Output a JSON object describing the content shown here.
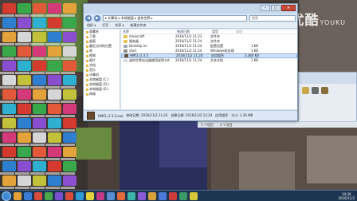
{
  "watermark": {
    "brand": "优酷",
    "sub": "YOUKU"
  },
  "window": {
    "address": "▸ 计算机 ▸ 本地磁盘 ▸ 迷你世界 ▸",
    "search_placeholder": "搜索",
    "buttons": {
      "minimize": "–",
      "maximize": "□",
      "close": "✕"
    }
  },
  "toolbar": {
    "items": [
      "组织 ▾",
      "打开",
      "共享 ▾",
      "新建文件夹"
    ]
  },
  "nav_pane": {
    "items": [
      {
        "label": "收藏夹"
      },
      {
        "label": "下载"
      },
      {
        "label": "桌面"
      },
      {
        "label": "最近访问的位置"
      },
      {
        "label": "库"
      },
      {
        "label": "视频"
      },
      {
        "label": "图片"
      },
      {
        "label": "文档"
      },
      {
        "label": "音乐"
      },
      {
        "label": "计算机"
      },
      {
        "label": "本地磁盘 (C:)"
      },
      {
        "label": "本地磁盘 (D:)"
      },
      {
        "label": "本地磁盘 (E:)"
      },
      {
        "label": "网络"
      }
    ]
  },
  "columns": {
    "name": "名称",
    "date": "修改日期",
    "type": "类型",
    "size": "大小"
  },
  "files": [
    {
      "name": "minecraft",
      "date": "2016/11/2 11:23",
      "type": "文件夹",
      "size": "",
      "icon_color": "#e7c04e"
    },
    {
      "name": "服务器",
      "date": "2016/11/2 11:24",
      "type": "文件夹",
      "size": "",
      "icon_color": "#e7c04e"
    },
    {
      "name": "Desktop.ini",
      "date": "2016/11/2 11:24",
      "type": "配置设置",
      "size": "1 KB",
      "icon_color": "#9aa7b5"
    },
    {
      "name": "start",
      "date": "2016/11/2 11:24",
      "type": "Windows批处理",
      "size": "1 KB",
      "icon_color": "#8c8c8c"
    },
    {
      "name": "HMCL-2.3.5",
      "date": "2016/11/2 11:24",
      "type": "应用程序",
      "size": "3,384 KB",
      "icon_color": "#6b4a2b",
      "selected": true
    },
    {
      "name": "迷你世界启动器使用说明.txt",
      "date": "2016/11/2 11:24",
      "type": "文本文档",
      "size": "1 KB",
      "icon_color": "#d6d6d6"
    }
  ],
  "details": {
    "name": "HMCL-2.3.5.exe",
    "modified": "修改日期: 2016/11/2 11:24",
    "created": "创建日期: 2016/11/2 11:24",
    "kind": "应用程序",
    "size": "大小: 3.30 MB"
  },
  "back_window": {
    "status": [
      "1 个项目",
      "1 个项目"
    ]
  },
  "taskbar": {
    "time": "10:36",
    "date": "2016/11/2",
    "apps": [
      "#e3a13a",
      "#3a7bd5",
      "#d84b3a",
      "#4aa84a",
      "#7a4fcf",
      "#d84b3a",
      "#2f9ad6",
      "#e3d23a",
      "#c23a8a",
      "#5a8fd6",
      "#e36a3a",
      "#3ab5a8",
      "#8a5ad6",
      "#d6a03a",
      "#4a7ad6",
      "#cf3a3a",
      "#3a9a6a",
      "#d6c63a"
    ]
  },
  "desktop_icon_colors": [
    "#d43a2e",
    "#2f7fd0",
    "#e3a33a",
    "#39a84a",
    "#8a4fd0",
    "#d6d6d6",
    "#e35a3a",
    "#2fb0d0",
    "#c2c23a",
    "#d43a7a"
  ]
}
